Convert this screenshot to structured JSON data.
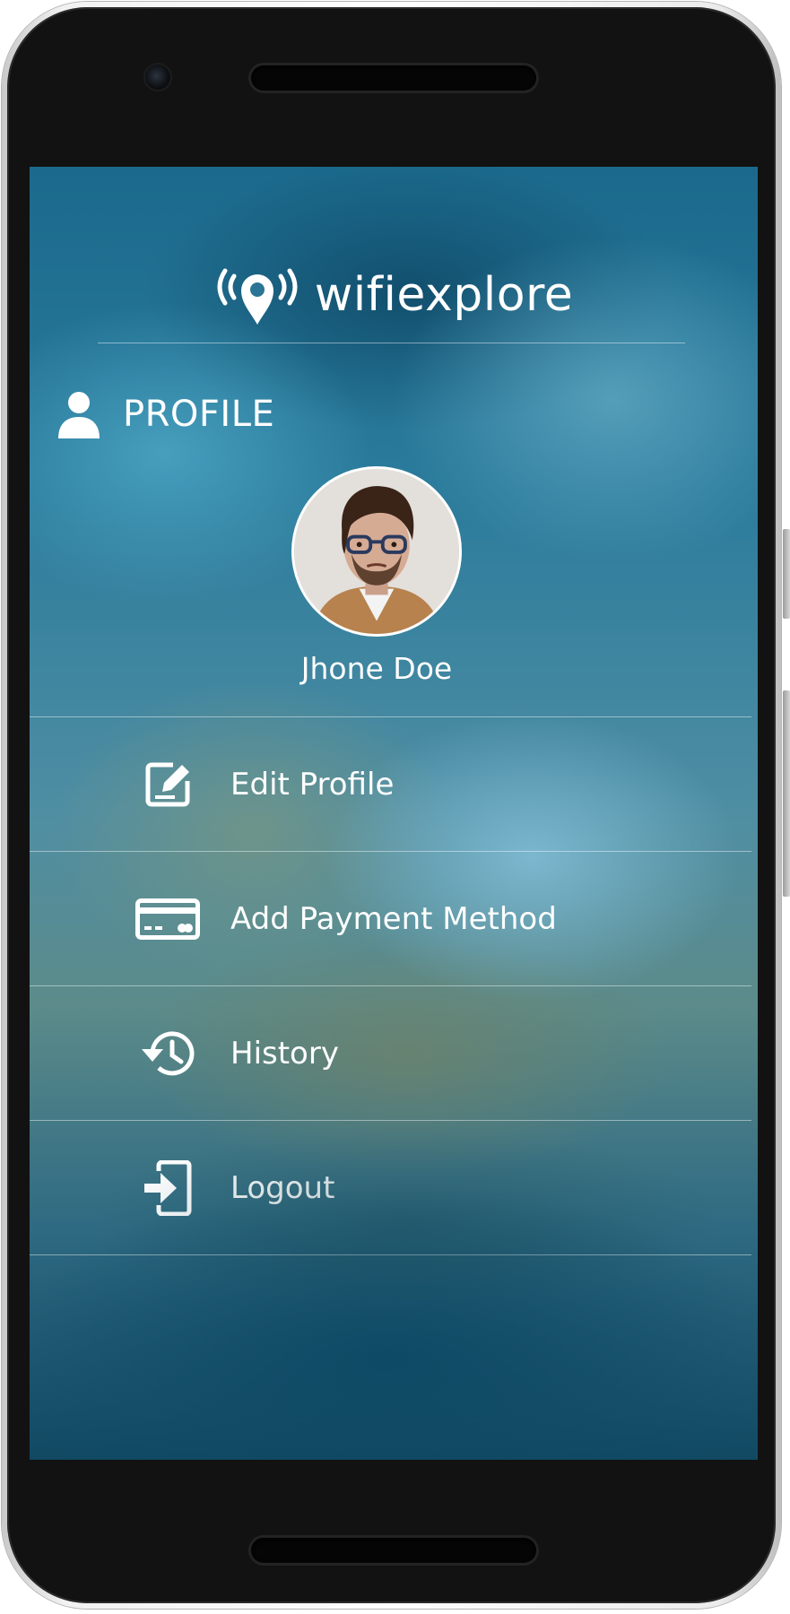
{
  "app": {
    "brand_name": "wifiexplore"
  },
  "profile": {
    "section_title": "PROFILE",
    "user_name": "Jhone Doe"
  },
  "menu": {
    "items": [
      {
        "label": "Edit Profile",
        "icon": "edit-icon"
      },
      {
        "label": "Add Payment Method",
        "icon": "credit-card-icon"
      },
      {
        "label": "History",
        "icon": "history-icon"
      },
      {
        "label": "Logout",
        "icon": "logout-icon"
      }
    ]
  },
  "colors": {
    "text": "#ffffff",
    "divider": "rgba(255,255,255,0.45)",
    "background_top": "#1b6a8d",
    "background_bottom": "#114963"
  }
}
